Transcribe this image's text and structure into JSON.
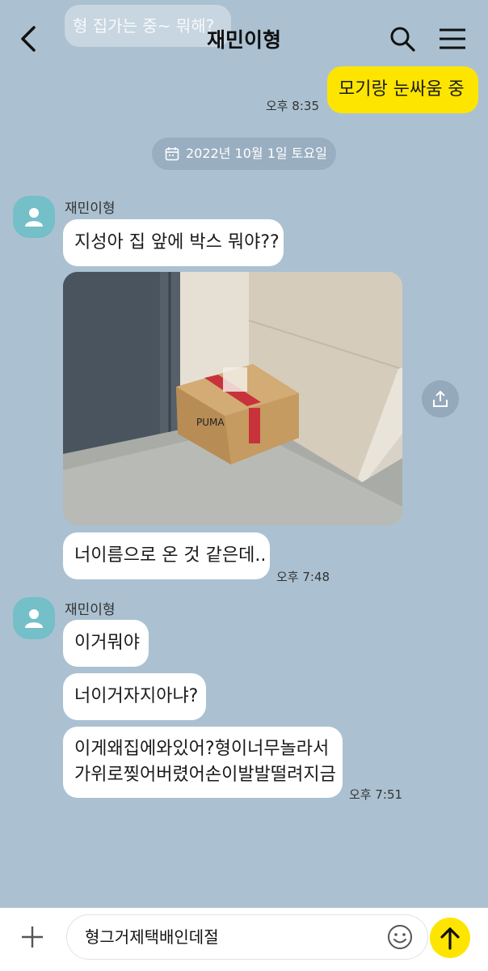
{
  "header": {
    "title": "재민이형"
  },
  "faded_preview": "형 집가는 중~ 뭐해?",
  "messages": {
    "m1": {
      "text": "모기랑 눈싸움 중",
      "time": "오후 8:35"
    },
    "date": "2022년 10월 1일 토요일",
    "g1": {
      "sender": "재민이형",
      "b1": "지성아 집 앞에 박스 뭐야??",
      "b2": "너이름으로 온 것 같은데..",
      "time": "오후 7:48"
    },
    "g2": {
      "sender": "재민이형",
      "b1": "이거뭐야",
      "b2": "너이거자지아냐?",
      "b3_line1": "이게왜집에와있어?형이너무놀라서",
      "b3_line2": "가위로찢어버렸어손이발발떨려지금",
      "time": "오후 7:51"
    }
  },
  "composer": {
    "value": "형그거제택배인데절"
  },
  "colors": {
    "background": "#abc1d1",
    "my_bubble": "#fee500",
    "their_bubble": "#ffffff",
    "avatar": "#74bfc8"
  },
  "icons": [
    "back-arrow-icon",
    "search-icon",
    "menu-icon",
    "calendar-icon",
    "profile-icon",
    "share-icon",
    "plus-icon",
    "emoji-icon",
    "send-arrow-icon"
  ]
}
